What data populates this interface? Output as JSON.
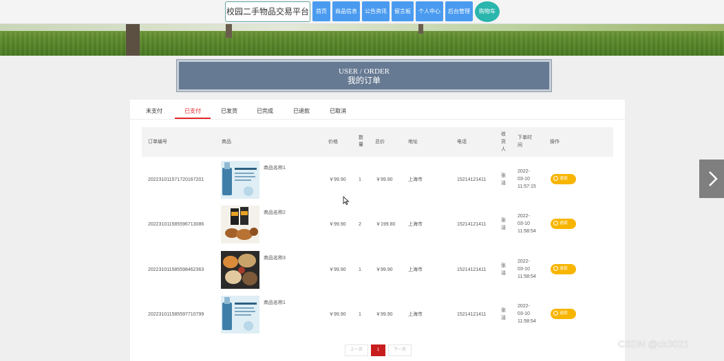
{
  "site": {
    "title": "校园二手物品交易平台"
  },
  "nav": [
    "首页",
    "商品信息",
    "公告资讯",
    "留言板",
    "个人中心",
    "后台管理",
    "购物车"
  ],
  "header": {
    "en": "USER / ORDER",
    "cn": "我的订单"
  },
  "tabs": [
    {
      "label": "未支付",
      "active": false
    },
    {
      "label": "已支付",
      "active": true
    },
    {
      "label": "已发货",
      "active": false
    },
    {
      "label": "已完成",
      "active": false
    },
    {
      "label": "已退款",
      "active": false
    },
    {
      "label": "已取消",
      "active": false
    }
  ],
  "table": {
    "headers": {
      "order_no": "订单编号",
      "goods": "商品",
      "price": "价格",
      "qty_1": "数",
      "qty_2": "量",
      "total": "总价",
      "address": "地址",
      "phone": "电话",
      "receiver_1": "收",
      "receiver_2": "货",
      "receiver_3": "人",
      "time_1": "下单时",
      "time_2": "间",
      "action": "操作"
    },
    "rows": [
      {
        "order_no": "202231011571720167201",
        "goods": "商品名称1",
        "price": "￥99.90",
        "qty": "1",
        "total": "￥99.90",
        "address": "上海市",
        "phone": "15214121411",
        "receiver_1": "张",
        "receiver_2": "洁",
        "date_1": "2022-",
        "date_2": "03-10",
        "date_3": "11:57:15",
        "action": "退款",
        "thumb": "serum"
      },
      {
        "order_no": "202231011585596713086",
        "goods": "商品名称2",
        "price": "￥99.90",
        "qty": "2",
        "total": "￥199.80",
        "address": "上海市",
        "phone": "15214121411",
        "receiver_1": "张",
        "receiver_2": "洁",
        "date_1": "2022-",
        "date_2": "03-10",
        "date_3": "11:58:54",
        "action": "退款",
        "thumb": "snacks"
      },
      {
        "order_no": "202231011585598462363",
        "goods": "商品名称3",
        "price": "￥99.90",
        "qty": "1",
        "total": "￥99.90",
        "address": "上海市",
        "phone": "15214121411",
        "receiver_1": "张",
        "receiver_2": "洁",
        "date_1": "2022-",
        "date_2": "03-10",
        "date_3": "11:58:54",
        "action": "退款",
        "thumb": "food"
      },
      {
        "order_no": "202231011585597710799",
        "goods": "商品名称1",
        "price": "￥99.90",
        "qty": "1",
        "total": "￥99.90",
        "address": "上海市",
        "phone": "15214121411",
        "receiver_1": "张",
        "receiver_2": "洁",
        "date_1": "2022-",
        "date_2": "03-10",
        "date_3": "11:58:54",
        "action": "退款",
        "thumb": "serum"
      }
    ]
  },
  "pager": {
    "prev": "上一页",
    "current": "1",
    "next": "下一页"
  },
  "watermark": "CSDN @ck3021",
  "colors": {
    "nav": "#4a9bf0",
    "cart": "#2ab5ad",
    "accent": "#e3252a",
    "refund": "#f7b500",
    "header_bg": "#677a93"
  }
}
